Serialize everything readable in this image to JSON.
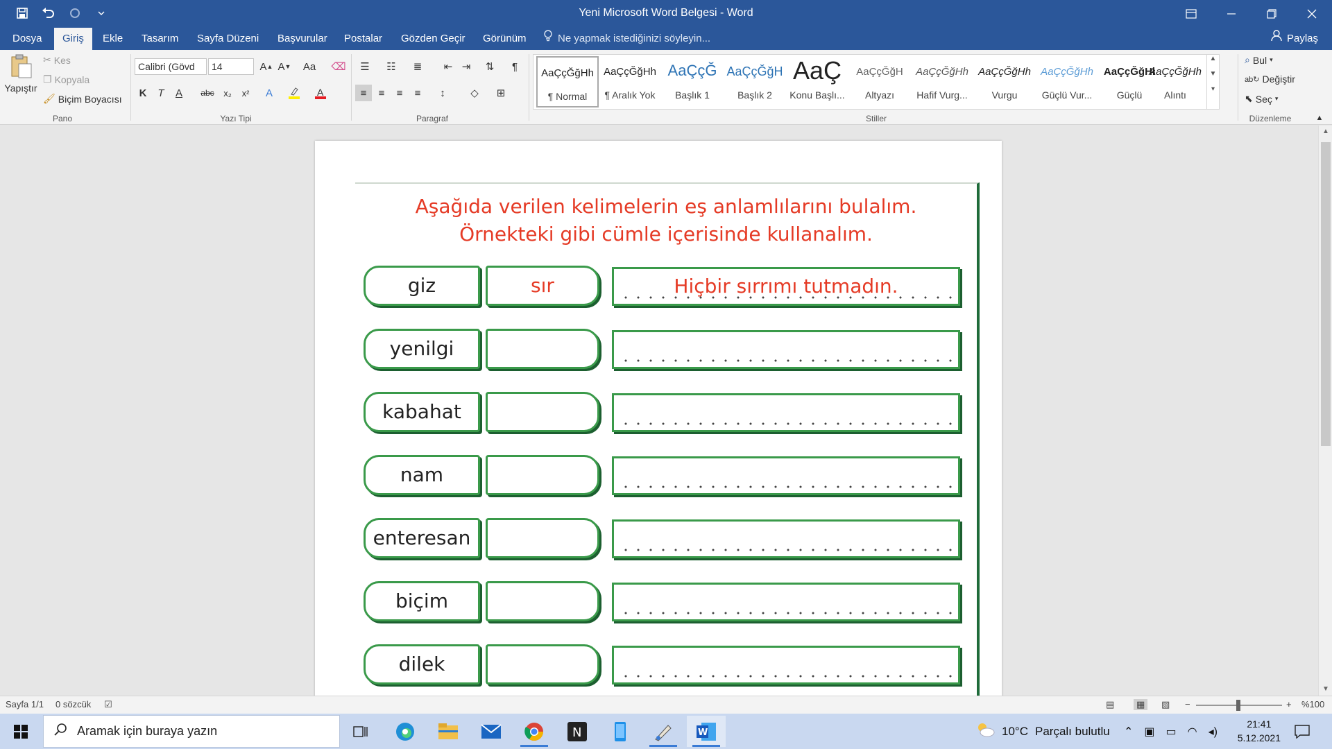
{
  "window": {
    "title": "Yeni Microsoft Word Belgesi - Word"
  },
  "tabs": [
    {
      "label": "Dosya"
    },
    {
      "label": "Giriş"
    },
    {
      "label": "Ekle"
    },
    {
      "label": "Tasarım"
    },
    {
      "label": "Sayfa Düzeni"
    },
    {
      "label": "Başvurular"
    },
    {
      "label": "Postalar"
    },
    {
      "label": "Gözden Geçir"
    },
    {
      "label": "Görünüm"
    }
  ],
  "tell_me": "Ne yapmak istediğinizi söyleyin...",
  "share_label": "Paylaş",
  "ribbon": {
    "clipboard": {
      "group": "Pano",
      "paste": "Yapıştır",
      "cut": "Kes",
      "copy": "Kopyala",
      "format_painter": "Biçim Boyacısı"
    },
    "font": {
      "group": "Yazı Tipi",
      "font_name": "Calibri (Gövd",
      "font_size": "14",
      "change_case": "Aa",
      "bold": "K",
      "italic": "T",
      "underline": "A",
      "strike": "abc",
      "subscript": "x₂",
      "superscript": "x²"
    },
    "paragraph": {
      "group": "Paragraf"
    },
    "styles": {
      "group": "Stiller",
      "items": [
        {
          "sample": "AaÇçĞğHh",
          "name": "¶ Normal"
        },
        {
          "sample": "AaÇçĞğHh",
          "name": "¶ Aralık Yok"
        },
        {
          "sample": "AaÇçĞ",
          "name": "Başlık 1"
        },
        {
          "sample": "AaÇçĞğH",
          "name": "Başlık 2"
        },
        {
          "sample": "AaÇ",
          "name": "Konu Başlı..."
        },
        {
          "sample": "AaÇçĞğH",
          "name": "Altyazı"
        },
        {
          "sample": "AaÇçĞğHh",
          "name": "Hafif Vurg..."
        },
        {
          "sample": "AaÇçĞğHh",
          "name": "Vurgu"
        },
        {
          "sample": "AaÇçĞğHh",
          "name": "Güçlü Vur..."
        },
        {
          "sample": "AaÇçĞğHł",
          "name": "Güçlü"
        },
        {
          "sample": "AaÇçĞğHh",
          "name": "Alıntı"
        }
      ]
    },
    "editing": {
      "group": "Düzenleme",
      "find": "Bul",
      "replace": "Değiştir",
      "select": "Seç"
    }
  },
  "worksheet": {
    "title_line1": "Aşağıda verilen kelimelerin eş anlamlılarını bulalım.",
    "title_line2": "Örnekteki gibi cümle içerisinde kullanalım.",
    "rows": [
      {
        "word": "giz",
        "synonym": "sır",
        "sentence": "Hiçbir sırrımı tutmadın."
      },
      {
        "word": "yenilgi",
        "synonym": "",
        "sentence": ""
      },
      {
        "word": "kabahat",
        "synonym": "",
        "sentence": ""
      },
      {
        "word": "nam",
        "synonym": "",
        "sentence": ""
      },
      {
        "word": "enteresan",
        "synonym": "",
        "sentence": ""
      },
      {
        "word": "biçim",
        "synonym": "",
        "sentence": ""
      },
      {
        "word": "dilek",
        "synonym": "",
        "sentence": ""
      }
    ]
  },
  "status": {
    "page": "Sayfa 1/1",
    "words": "0 sözcük",
    "zoom": "%100"
  },
  "taskbar": {
    "search_placeholder": "Aramak için buraya yazın",
    "weather_temp": "10°C",
    "weather_desc": "Parçalı bulutlu",
    "time": "21:41",
    "date": "5.12.2021"
  },
  "colors": {
    "word_blue": "#2b579a",
    "worksheet_red": "#e53a25",
    "worksheet_green": "#3a9a4a"
  }
}
